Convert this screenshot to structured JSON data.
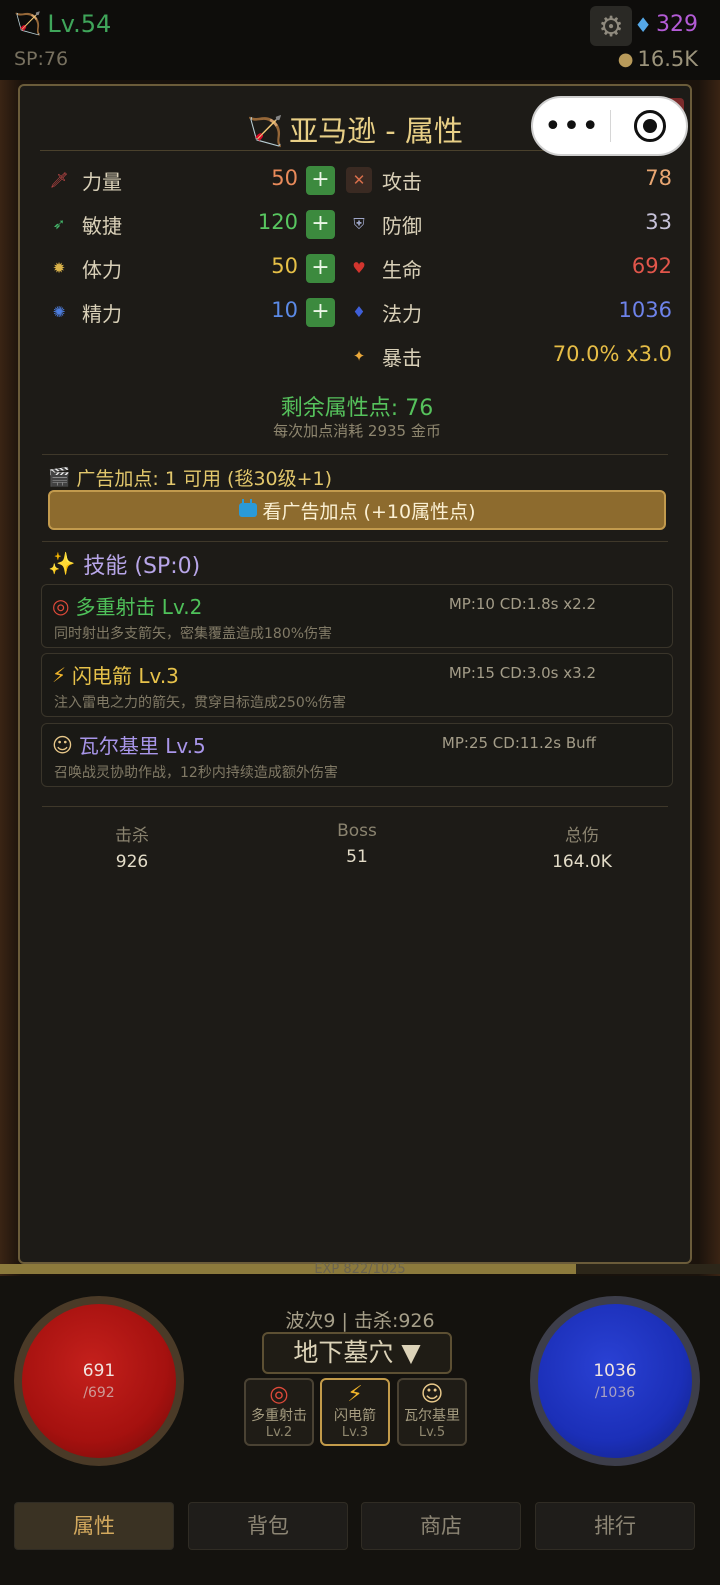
{
  "topbar": {
    "level": "Lv.54",
    "sp": "SP:76",
    "gems": "329",
    "gold": "16.5K"
  },
  "panel": {
    "title": "亚马逊 - 属性",
    "close_label": "X",
    "capsule": {
      "more_glyph": "•••"
    },
    "attributes": [
      {
        "label": "力量",
        "value": "50",
        "icon": "strength-icon",
        "color": "#e88a5a"
      },
      {
        "label": "敏捷",
        "value": "120",
        "icon": "agility-icon",
        "color": "#58c760"
      },
      {
        "label": "体力",
        "value": "50",
        "icon": "vitality-icon",
        "color": "#e6c047"
      },
      {
        "label": "精力",
        "value": "10",
        "icon": "energy-icon",
        "color": "#5b8ae6"
      }
    ],
    "plus_label": "+",
    "derived": [
      {
        "label": "攻击",
        "value": "78",
        "icon": "attack-icon",
        "color": "#e8a672"
      },
      {
        "label": "防御",
        "value": "33",
        "icon": "defense-icon",
        "color": "#c6c2d8"
      },
      {
        "label": "生命",
        "value": "692",
        "icon": "life-icon",
        "color": "#e2564b"
      },
      {
        "label": "法力",
        "value": "1036",
        "icon": "mana-icon",
        "color": "#6e83ea"
      },
      {
        "label": "暴击",
        "value": "70.0%  x3.0",
        "icon": "crit-icon",
        "color": "#e6bd46"
      }
    ],
    "remaining_points": "剩余属性点: 76",
    "cost_note": "每次加点消耗 2935 金币",
    "ad_line": "广告加点: 1 可用 (毯30级+1)",
    "ad_button": "看广告加点 (+10属性点)",
    "skills_title": "技能 (SP:0)",
    "skills": [
      {
        "name": "多重射击 Lv.2",
        "meta": "MP:10 CD:1.8s x2.2",
        "desc": "同时射出多支箭矢，密集覆盖造成180%伤害",
        "icon": "target-icon",
        "color": "#4fc25a"
      },
      {
        "name": "闪电箭 Lv.3",
        "meta": "MP:15 CD:3.0s x3.2",
        "desc": "注入雷电之力的箭矢，贯穿目标造成250%伤害",
        "icon": "lightning-icon",
        "color": "#e7c24a"
      },
      {
        "name": "瓦尔基里 Lv.5",
        "meta": "MP:25 CD:11.2s Buff",
        "desc": "召唤战灵协助作战，12秒内持续造成额外伤害",
        "icon": "valkyrie-icon",
        "color": "#a996ea"
      }
    ],
    "summary": [
      {
        "label": "击杀",
        "value": "926"
      },
      {
        "label": "Boss",
        "value": "51"
      },
      {
        "label": "总伤",
        "value": "164.0K"
      }
    ]
  },
  "hud": {
    "exp_text": "EXP 822/1025",
    "exp_fraction": 0.8,
    "hp_current": "691",
    "hp_max": "/692",
    "mp_current": "1036",
    "mp_max": "/1036",
    "wave_text": "波次9 | 击杀:926",
    "zone": "地下墓穴 ▼",
    "quick_skills": [
      {
        "name": "多重射击",
        "level": "Lv.2",
        "icon": "target-icon"
      },
      {
        "name": "闪电箭",
        "level": "Lv.3",
        "icon": "lightning-icon"
      },
      {
        "name": "瓦尔基里",
        "level": "Lv.5",
        "icon": "valkyrie-icon"
      }
    ]
  },
  "tabs": [
    "属性",
    "背包",
    "商店",
    "排行"
  ]
}
